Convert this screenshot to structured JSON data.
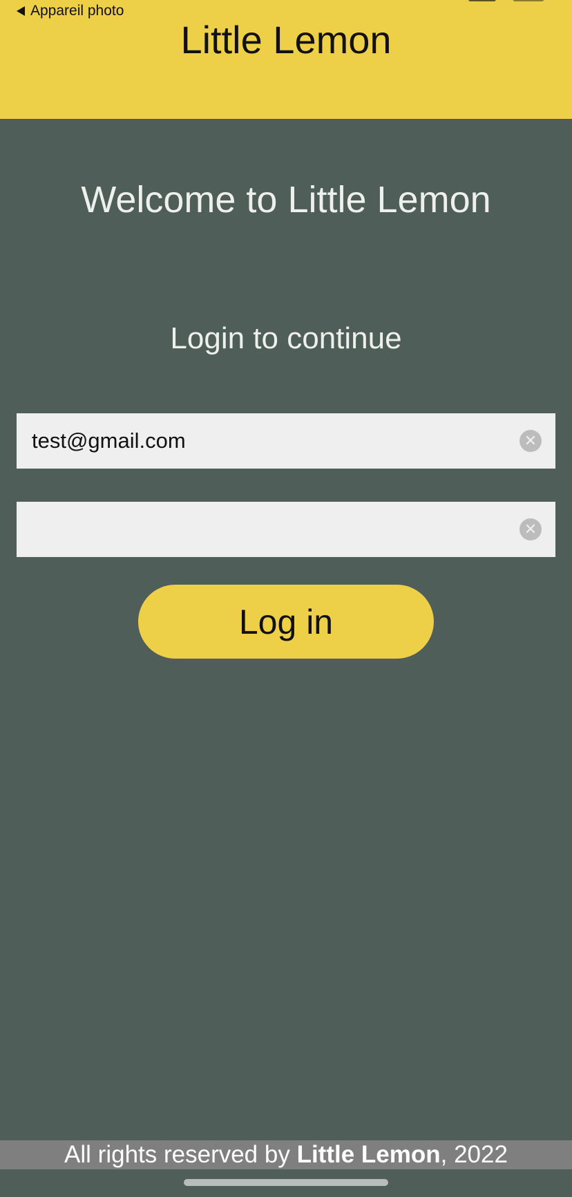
{
  "status_bar": {
    "back_label": "Appareil photo"
  },
  "header": {
    "title": "Little Lemon"
  },
  "main": {
    "welcome": "Welcome to Little Lemon",
    "subtitle": "Login to continue",
    "email_value": "test@gmail.com",
    "password_value": "",
    "clear_glyph": "✕",
    "login_label": "Log in"
  },
  "footer": {
    "prefix": "All rights reserved by ",
    "brand": "Little Lemon",
    "suffix": ", 2022"
  },
  "colors": {
    "header_bg": "#eecf48",
    "page_bg": "#4f5e58",
    "input_bg": "#efefef",
    "footer_bg": "#7f7f7f"
  },
  "icons": {
    "back": "back-arrow-icon",
    "clear": "clear-icon"
  }
}
